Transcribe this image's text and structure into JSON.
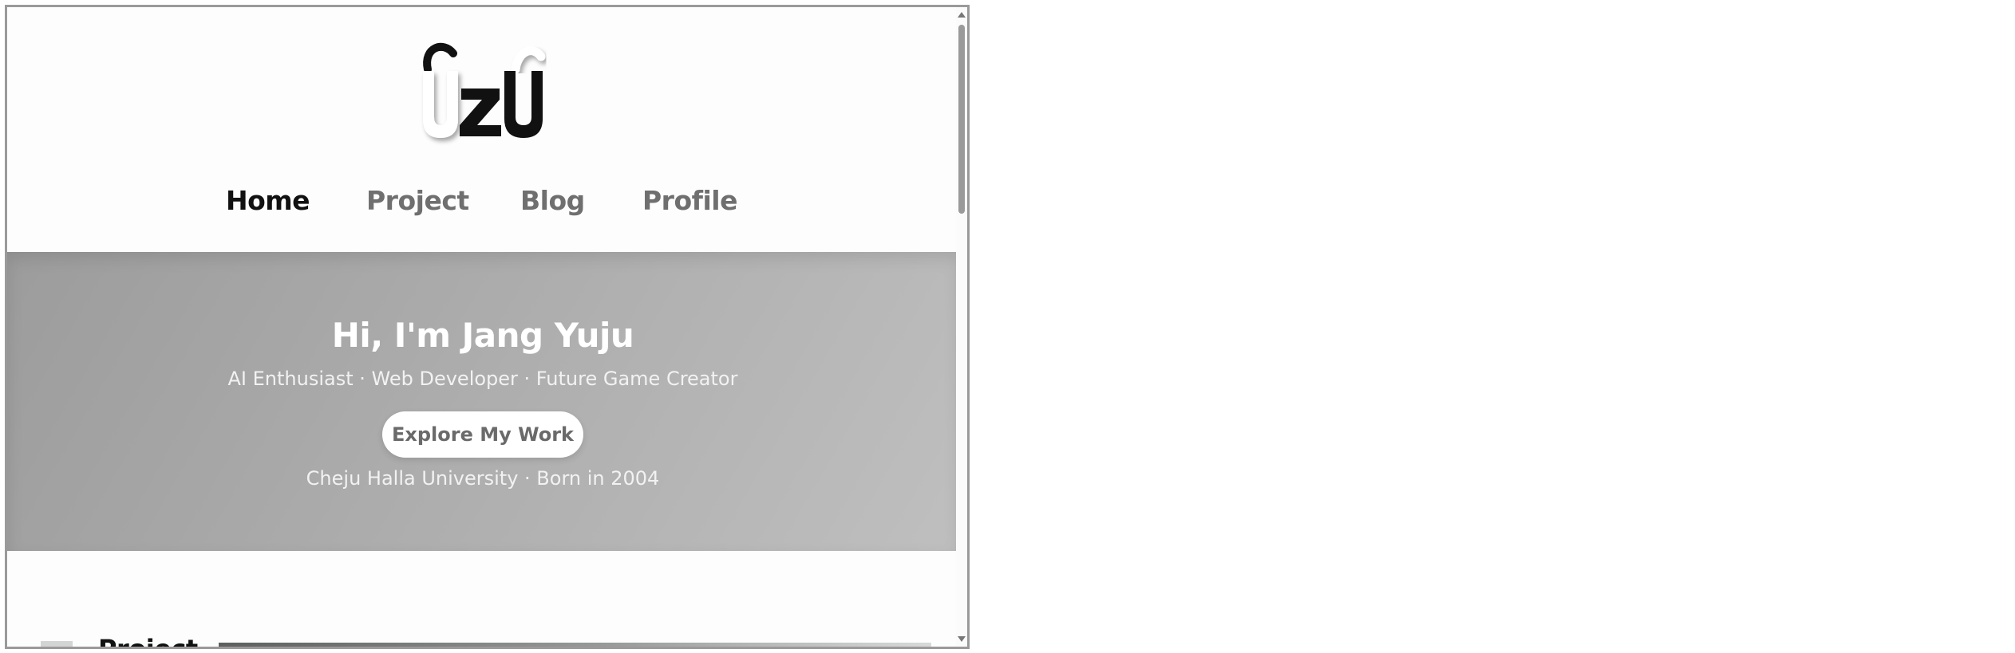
{
  "logo": {
    "text": "UZU"
  },
  "nav": {
    "items": [
      {
        "label": "Home",
        "active": true
      },
      {
        "label": "Project",
        "active": false
      },
      {
        "label": "Blog",
        "active": false
      },
      {
        "label": "Profile",
        "active": false
      }
    ]
  },
  "hero": {
    "title": "Hi, I'm Jang Yuju",
    "subtitle": "AI Enthusiast · Web Developer · Future Game Creator",
    "cta_label": "Explore My Work",
    "meta": "Cheju Halla University · Born in 2004"
  },
  "section": {
    "title": "Project"
  },
  "colors": {
    "nav_active": "#111111",
    "nav_inactive": "#6f6f6f",
    "hero_gradient_start": "#9c9c9c",
    "hero_gradient_end": "#bfbfbf",
    "cta_background": "#ffffff",
    "cta_text": "#6a6a6a"
  },
  "icons": {
    "scroll_up": "scroll-up-arrow-icon",
    "scroll_down": "scroll-down-arrow-icon"
  }
}
